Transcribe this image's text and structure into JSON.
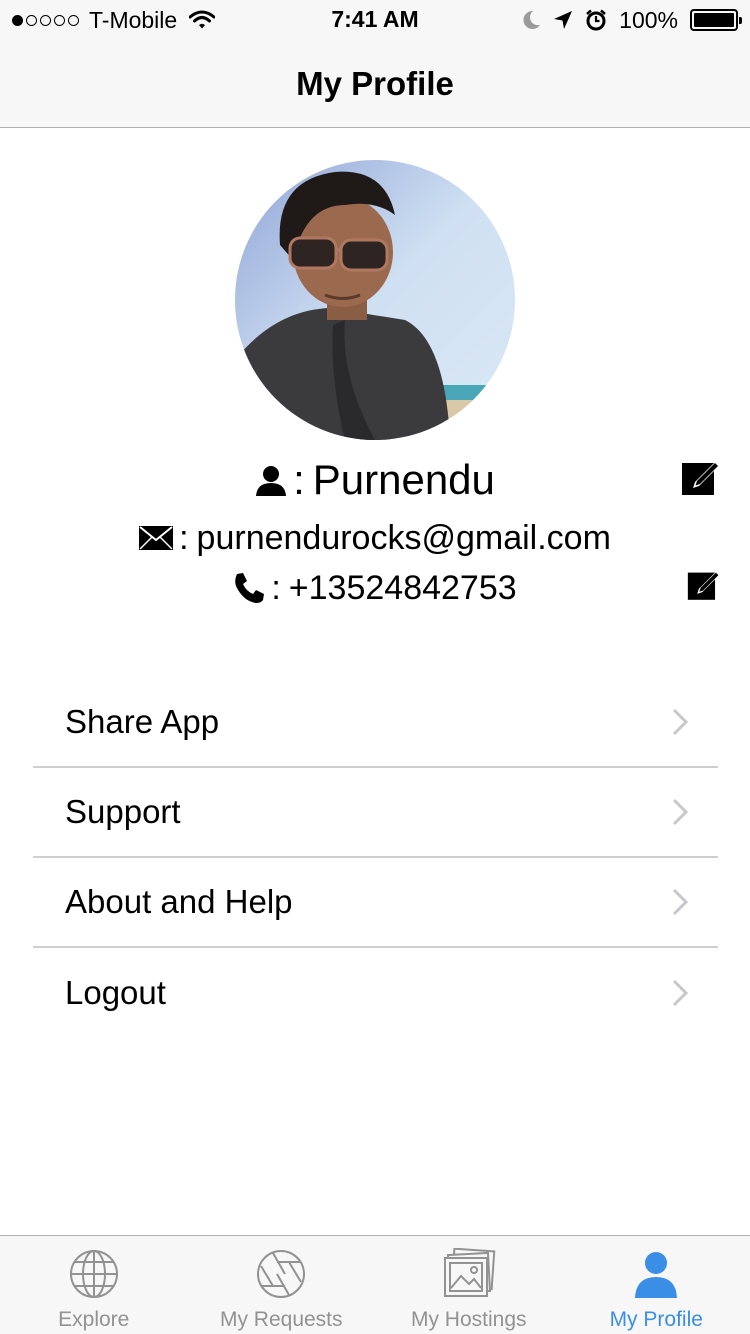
{
  "status_bar": {
    "carrier": "T-Mobile",
    "signal_bars_filled": 1,
    "signal_bars_total": 5,
    "time": "7:41 AM",
    "battery_percent": "100%"
  },
  "nav": {
    "title": "My Profile"
  },
  "profile": {
    "name": "Purnendu",
    "email": "purnendurocks@gmail.com",
    "phone": "+13524842753",
    "separator": ":"
  },
  "menu": {
    "items": [
      {
        "label": "Share App"
      },
      {
        "label": "Support"
      },
      {
        "label": "About and Help"
      },
      {
        "label": "Logout"
      }
    ]
  },
  "tab_bar": {
    "tabs": [
      {
        "label": "Explore",
        "icon": "globe-icon",
        "active": false
      },
      {
        "label": "My Requests",
        "icon": "aperture-icon",
        "active": false
      },
      {
        "label": "My Hostings",
        "icon": "photos-icon",
        "active": false
      },
      {
        "label": "My Profile",
        "icon": "person-icon",
        "active": true
      }
    ]
  },
  "colors": {
    "accent": "#3a8ee6",
    "inactive_tab": "#929292",
    "bar_background": "#f7f7f7",
    "divider": "#cfcfcf",
    "chevron": "#c7c7cc"
  }
}
